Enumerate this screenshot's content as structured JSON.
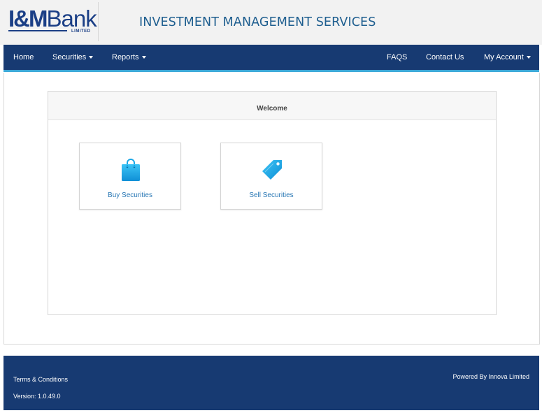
{
  "brand": {
    "logo_im": "I&M",
    "logo_bank": "Bank",
    "logo_sub": "LIMITED",
    "app_title": "INVESTMENT MANAGEMENT SERVICES"
  },
  "nav": {
    "home": "Home",
    "securities": "Securities",
    "reports": "Reports",
    "faqs": "FAQS",
    "contact": "Contact Us",
    "account": "My Account"
  },
  "panel": {
    "heading": "Welcome",
    "tiles": [
      {
        "label": "Buy Securities",
        "icon": "shopping-bag-icon"
      },
      {
        "label": "Sell Securities",
        "icon": "price-tag-icon"
      }
    ]
  },
  "footer": {
    "terms": "Terms & Conditions",
    "version": "Version: 1.0.49.0",
    "powered": "Powered By Innova Limited"
  },
  "colors": {
    "navbar": "#173a72",
    "accent": "#3ca9d8",
    "title": "#1e5e8f",
    "link": "#2a78b5",
    "icon": "#1aa7e6"
  }
}
